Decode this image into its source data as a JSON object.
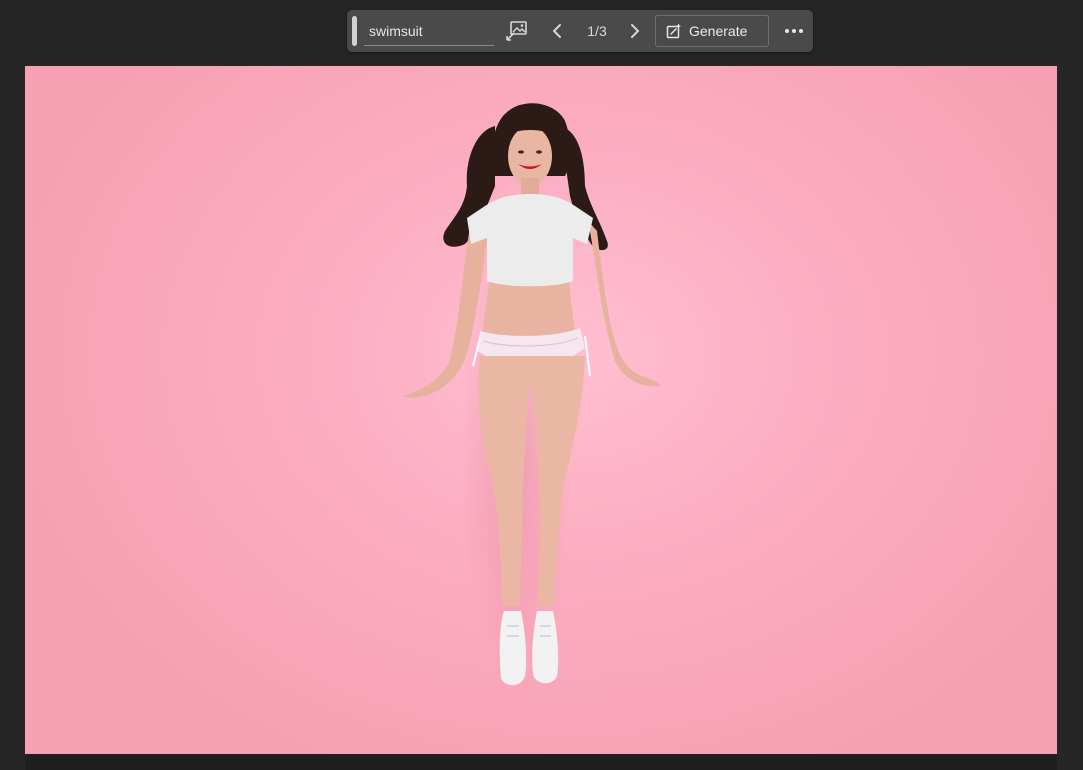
{
  "taskbar": {
    "prompt_value": "swimsuit",
    "counter": "1/3",
    "generate_label": "Generate",
    "icons": {
      "image": "image-reference-icon",
      "prev": "chevron-left-icon",
      "next": "chevron-right-icon",
      "generate": "generative-fill-icon",
      "more": "more-options-icon"
    }
  },
  "canvas": {
    "content": "photo",
    "colors": {
      "background": "#f9a7ba",
      "highlight": "#ffbfd1",
      "top": "#ececec",
      "bottoms": "#f5e6ef",
      "hair": "#2b1a16",
      "skin": "#e9b6a3",
      "lips": "#c8102e",
      "shoes": "#f2f2f2"
    }
  },
  "colors": {
    "app_background": "#262626",
    "taskbar_background": "#4a4a4a",
    "text": "#e6e6e6"
  }
}
